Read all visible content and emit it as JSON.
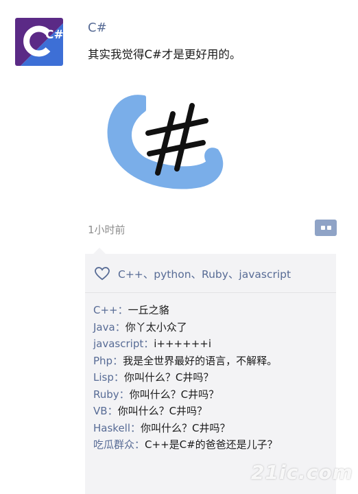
{
  "post": {
    "author": "C#",
    "text": "其实我觉得C#才是更好用的。",
    "timestamp": "1小时前",
    "avatar_text": "C#",
    "image_symbol": "#"
  },
  "likes": {
    "names": "C++、python、Ruby、javascript",
    "icon": "heart-icon"
  },
  "comments": [
    {
      "author": "C++",
      "sep": "：",
      "text": "一丘之貉"
    },
    {
      "author": "Java",
      "sep": "：",
      "text": "你丫太小众了"
    },
    {
      "author": "javascript",
      "sep": "：",
      "text": "i++++++i"
    },
    {
      "author": "Php",
      "sep": "：",
      "text": "我是全世界最好的语言，不解释。"
    },
    {
      "author": "Lisp",
      "sep": "：",
      "text": "你叫什么？C井吗？"
    },
    {
      "author": "Ruby",
      "sep": "：",
      "text": "你叫什么？C井吗？"
    },
    {
      "author": "VB",
      "sep": "：",
      "text": "你叫什么？C井吗？"
    },
    {
      "author": "Haskell",
      "sep": "：",
      "text": "你叫什么？C井吗？"
    },
    {
      "author": "吃瓜群众",
      "sep": "：",
      "text": "C++是C#的爸爸还是儿子？"
    }
  ],
  "watermark": "21ic.com",
  "colors": {
    "name_blue": "#576b95",
    "avatar_purple": "#5b2a86",
    "avatar_blue": "#3d6fd6",
    "image_brush_blue": "#7aaee9",
    "comment_button": "#8fa3c6"
  }
}
